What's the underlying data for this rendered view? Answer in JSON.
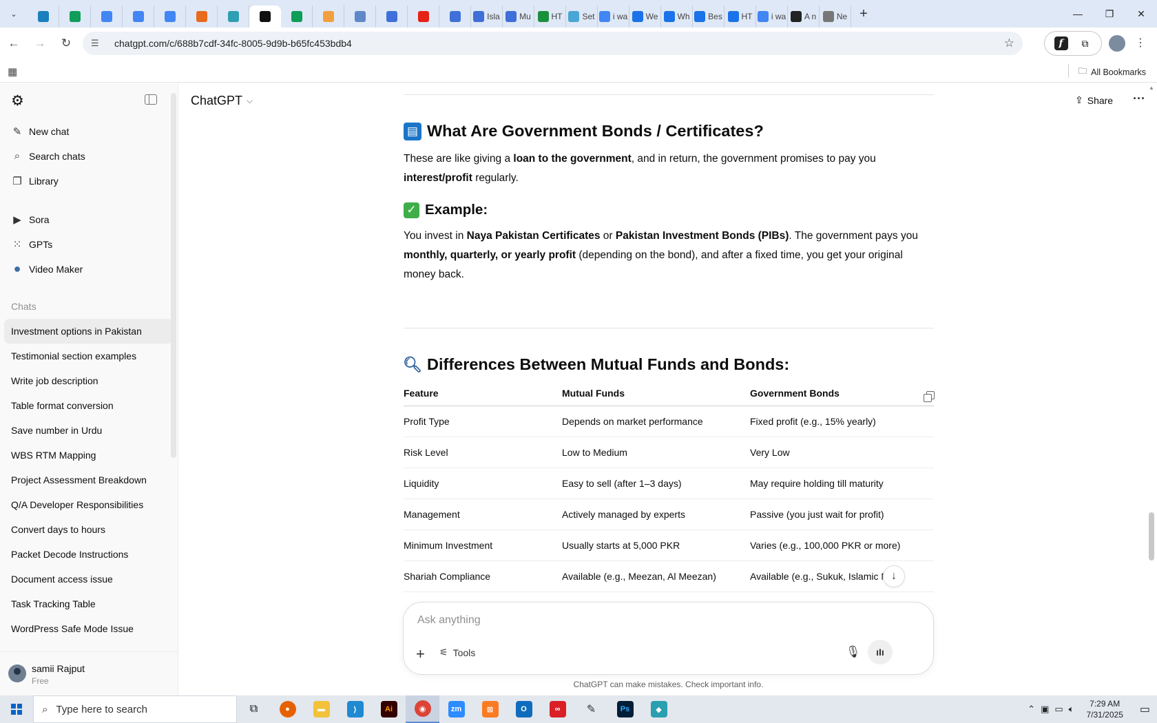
{
  "browser": {
    "tabs": [
      {
        "label": "",
        "icon": "bing-icon",
        "color": "#1a7fbd"
      },
      {
        "label": "",
        "icon": "sheets-icon",
        "color": "#0f9d58"
      },
      {
        "label": "",
        "icon": "docs-icon",
        "color": "#4285f4"
      },
      {
        "label": "",
        "icon": "docs-icon",
        "color": "#4285f4"
      },
      {
        "label": "",
        "icon": "docs-icon",
        "color": "#4285f4"
      },
      {
        "label": "",
        "icon": "app-icon",
        "color": "#e86a1d"
      },
      {
        "label": "",
        "icon": "app-icon",
        "color": "#2f9fb3"
      },
      {
        "label": "",
        "icon": "chatgpt-icon",
        "color": "#111111",
        "active": true
      },
      {
        "label": "",
        "icon": "sheets-icon",
        "color": "#0f9d58"
      },
      {
        "label": "",
        "icon": "app-icon",
        "color": "#f29f3f"
      },
      {
        "label": "",
        "icon": "app-icon",
        "color": "#5f88c9"
      },
      {
        "label": "",
        "icon": "forms-icon",
        "color": "#3f6fd8"
      },
      {
        "label": "",
        "icon": "youtube-icon",
        "color": "#e62117"
      },
      {
        "label": "",
        "icon": "forms-icon",
        "color": "#3f6fd8"
      },
      {
        "label": "Isla",
        "icon": "forms-icon",
        "color": "#3f6fd8"
      },
      {
        "label": "Mu",
        "icon": "forms-icon",
        "color": "#3f6fd8"
      },
      {
        "label": "HT",
        "icon": "w-icon",
        "color": "#1a8f3c"
      },
      {
        "label": "Set",
        "icon": "react-icon",
        "color": "#4aa6d6"
      },
      {
        "label": "i wa",
        "icon": "google-icon",
        "color": "#4285f4"
      },
      {
        "label": "We",
        "icon": "c-icon",
        "color": "#1a73e8"
      },
      {
        "label": "Wh",
        "icon": "c-icon",
        "color": "#1a73e8"
      },
      {
        "label": "Bes",
        "icon": "c-icon",
        "color": "#1a73e8"
      },
      {
        "label": "HT",
        "icon": "c-icon",
        "color": "#1a73e8"
      },
      {
        "label": "i wa",
        "icon": "google-icon",
        "color": "#4285f4"
      },
      {
        "label": "A n",
        "icon": "a-icon",
        "color": "#222222"
      },
      {
        "label": "Ne",
        "icon": "chrome-icon",
        "color": "#777777"
      }
    ],
    "url": "chatgpt.com/c/688b7cdf-34fc-8005-9d9b-b65fc453bdb4",
    "all_bookmarks": "All Bookmarks"
  },
  "sidebar": {
    "nav": [
      {
        "label": "New chat",
        "icon": "new-chat-icon"
      },
      {
        "label": "Search chats",
        "icon": "search-icon"
      },
      {
        "label": "Library",
        "icon": "library-icon"
      }
    ],
    "apps": [
      {
        "label": "Sora",
        "icon": "sora-icon"
      },
      {
        "label": "GPTs",
        "icon": "gpts-icon"
      },
      {
        "label": "Video Maker",
        "icon": "video-maker-icon"
      }
    ],
    "chats_heading": "Chats",
    "chats": [
      "Investment options in Pakistan",
      "Testimonial section examples",
      "Write job description",
      "Table format conversion",
      "Save number in Urdu",
      "WBS RTM Mapping",
      "Project Assessment Breakdown",
      "Q/A Developer Responsibilities",
      "Convert days to hours",
      "Packet Decode Instructions",
      "Document access issue",
      "Task Tracking Table",
      "WordPress Safe Mode Issue"
    ],
    "user": {
      "name": "samii Rajput",
      "plan": "Free"
    }
  },
  "header": {
    "model": "ChatGPT",
    "share": "Share"
  },
  "message": {
    "section1": {
      "title": "What Are Government Bonds / Certificates?",
      "p1": "These are like giving a ",
      "p1_b1": "loan to the government",
      "p1_2": ", and in return, the government promises to pay you ",
      "p1_b2": "interest/profit",
      "p1_3": " regularly."
    },
    "section2": {
      "title": "Example:",
      "p1": "You invest in ",
      "p1_b1": "Naya Pakistan Certificates",
      "p1_2": " or ",
      "p1_b2": "Pakistan Investment Bonds (PIBs)",
      "p1_3": ". The government pays you ",
      "p1_b3": "monthly, quarterly, or yearly profit",
      "p1_4": " (depending on the bond), and after a fixed time, you get your original money back."
    },
    "section3": {
      "title": "Differences Between Mutual Funds and Bonds:",
      "headers": [
        "Feature",
        "Mutual Funds",
        "Government Bonds"
      ],
      "rows": [
        [
          "Profit Type",
          "Depends on market performance",
          "Fixed profit (e.g., 15% yearly)"
        ],
        [
          "Risk Level",
          "Low to Medium",
          "Very Low"
        ],
        [
          "Liquidity",
          "Easy to sell (after 1–3 days)",
          "May require holding till maturity"
        ],
        [
          "Management",
          "Actively managed by experts",
          "Passive (you just wait for profit)"
        ],
        [
          "Minimum Investment",
          "Usually starts at 5,000 PKR",
          "Varies (e.g., 100,000 PKR or more)"
        ],
        [
          "Shariah Compliance",
          "Available (e.g., Meezan, Al Meezan)",
          "Available (e.g., Sukuk, Islamic NPC)"
        ]
      ]
    }
  },
  "composer": {
    "placeholder": "Ask anything",
    "tools": "Tools"
  },
  "disclaimer": "ChatGPT can make mistakes. Check important info.",
  "taskbar": {
    "search_placeholder": "Type here to search",
    "time": "7:29 AM",
    "date": "7/31/2025"
  }
}
